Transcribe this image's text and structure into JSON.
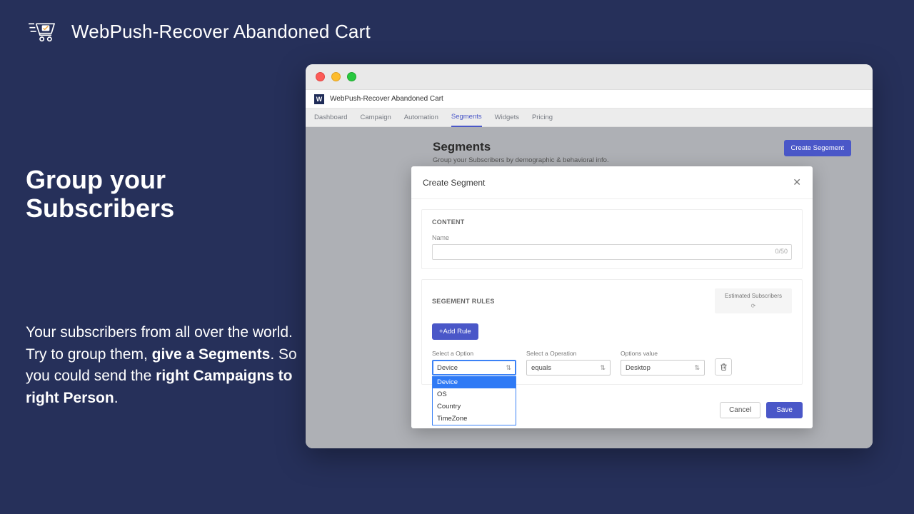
{
  "brand": {
    "title": "WebPush-Recover Abandoned Cart"
  },
  "leftCopy": {
    "headline": "Group your Subscribers",
    "body_plain_1": "Your subscribers from all over the world.",
    "body_plain_2": "Try to group them, ",
    "body_bold_1": "give a Segments",
    "body_plain_3": ". So you could send the ",
    "body_bold_2": "right Campaigns to right Person",
    "body_plain_4": "."
  },
  "appHeader": {
    "name": "WebPush-Recover Abandoned Cart"
  },
  "nav": {
    "tabs": [
      "Dashboard",
      "Campaign",
      "Automation",
      "Segments",
      "Widgets",
      "Pricing"
    ],
    "activeIndex": 3
  },
  "page": {
    "title": "Segments",
    "subtitle": "Group your Subscribers by demographic & behavioral info.",
    "createBtn": "Create Segement"
  },
  "modal": {
    "title": "Create Segment",
    "close": "✕",
    "content": {
      "section": "CONTENT",
      "nameLabel": "Name",
      "nameCounter": "0/50"
    },
    "rules": {
      "section": "SEGEMENT RULES",
      "estimatedLabel": "Estimated Subscribers",
      "addRule": "+Add Rule",
      "cols": {
        "optionLabel": "Select a Option",
        "operationLabel": "Select a Operation",
        "valueLabel": "Options value"
      },
      "row": {
        "optionValue": "Device",
        "operationValue": "equals",
        "valueValue": "Desktop"
      },
      "dropdown": {
        "options": [
          "Device",
          "OS",
          "Country",
          "TimeZone"
        ],
        "selectedIndex": 0
      }
    },
    "footer": {
      "cancel": "Cancel",
      "save": "Save"
    }
  }
}
